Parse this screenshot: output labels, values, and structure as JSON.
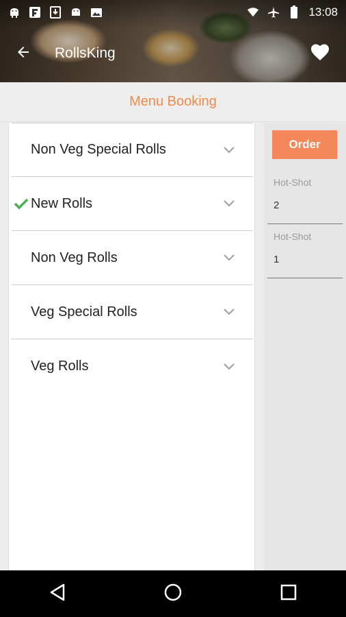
{
  "status_bar": {
    "time": "13:08",
    "left_icons": [
      "android-icon",
      "flipboard-icon",
      "download-icon",
      "android-icon",
      "image-icon"
    ],
    "right_icons": [
      "wifi-icon",
      "airplane-icon",
      "battery-icon"
    ]
  },
  "toolbar": {
    "title": "RollsKing"
  },
  "section": {
    "title": "Menu Booking"
  },
  "categories": [
    {
      "label": "Non Veg Special Rolls",
      "checked": false
    },
    {
      "label": "New Rolls",
      "checked": true
    },
    {
      "label": "Non Veg Rolls",
      "checked": false
    },
    {
      "label": "Veg Special Rolls",
      "checked": false
    },
    {
      "label": "Veg Rolls",
      "checked": false
    }
  ],
  "order": {
    "button_label": "Order",
    "items": [
      {
        "name": "Hot-Shot",
        "qty": "2"
      },
      {
        "name": "Hot-Shot",
        "qty": "1"
      }
    ]
  },
  "colors": {
    "accent": "#f08a4c",
    "order_button": "#f5885a",
    "check": "#4caf50"
  }
}
